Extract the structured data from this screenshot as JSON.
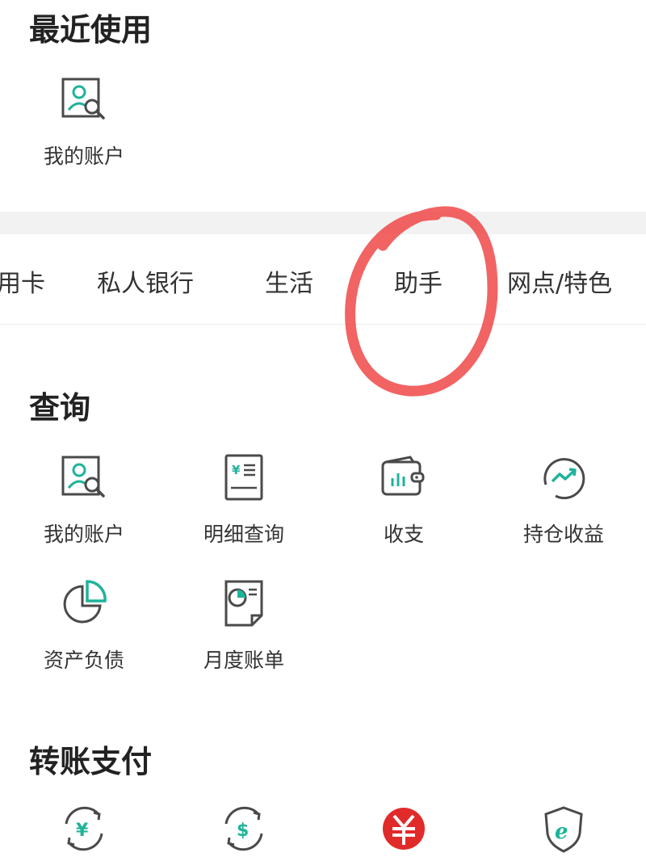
{
  "recent": {
    "title": "最近使用",
    "items": [
      {
        "label": "我的账户",
        "icon": "account-search-icon"
      }
    ]
  },
  "tabs": [
    {
      "label": "用卡"
    },
    {
      "label": "私人银行"
    },
    {
      "label": "生活"
    },
    {
      "label": "助手"
    },
    {
      "label": "网点/特色"
    }
  ],
  "query": {
    "title": "查询",
    "items": [
      {
        "label": "我的账户",
        "icon": "account-search-icon"
      },
      {
        "label": "明细查询",
        "icon": "bill-detail-icon"
      },
      {
        "label": "收支",
        "icon": "wallet-chart-icon"
      },
      {
        "label": "持仓收益",
        "icon": "trend-up-icon"
      },
      {
        "label": "资产负债",
        "icon": "pie-chart-icon"
      },
      {
        "label": "月度账单",
        "icon": "monthly-bill-icon"
      }
    ]
  },
  "transfer": {
    "title": "转账支付",
    "items": [
      {
        "label": "",
        "icon": "yuan-transfer-icon"
      },
      {
        "label": "",
        "icon": "dollar-transfer-icon"
      },
      {
        "label": "",
        "icon": "digital-rmb-icon"
      },
      {
        "label": "",
        "icon": "e-shield-icon"
      }
    ]
  },
  "annotation": {
    "color": "#f04848",
    "target": "助手"
  },
  "colors": {
    "accent": "#1fb39a",
    "icon_stroke": "#4a4a4a"
  }
}
